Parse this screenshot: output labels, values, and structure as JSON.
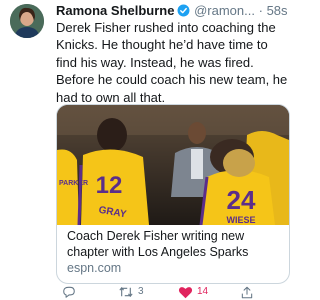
{
  "author": {
    "name": "Ramona Shelburne",
    "handle": "@ramon...",
    "separator": "·",
    "time": "58s"
  },
  "tweet_text": "Derek Fisher rushed into coaching the Knicks.  He thought he’d have time to find his way. Instead, he was fired. Before he could coach his new team, he had to own all that.",
  "card": {
    "title": "Coach Derek Fisher writing new chapter with Los Angeles Sparks",
    "domain": "espn.com",
    "jersey_left": "12",
    "jersey_left_name": "GRAY",
    "jersey_right": "24",
    "jersey_right_name": "WIESE",
    "jersey_edge_name": "PARKER"
  },
  "actions": {
    "reply_icon": "reply-icon",
    "retweet_icon": "retweet-icon",
    "retweet_count": "3",
    "like_icon": "heart-icon",
    "like_count": "14",
    "share_icon": "share-icon"
  },
  "colors": {
    "verified": "#1da1f2",
    "like": "#e0245e",
    "muted": "#657786",
    "jersey": "#f5c518"
  }
}
